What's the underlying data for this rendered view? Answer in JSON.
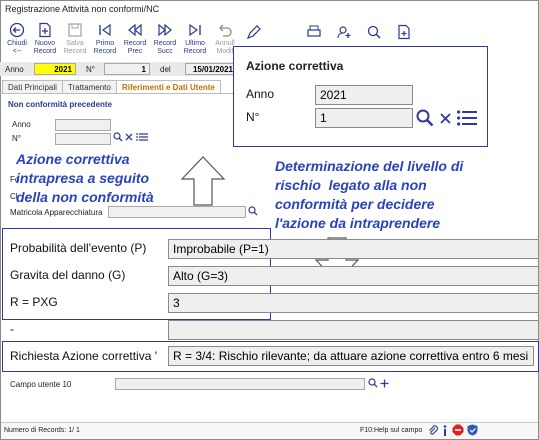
{
  "window": {
    "title": "Registrazione Attività non conformi/NC"
  },
  "toolbar": {
    "buttons": [
      {
        "label": "Chiudi\n<--"
      },
      {
        "label": "Nuovo\nRecord"
      },
      {
        "label": "Salva\nRecord"
      },
      {
        "label": "Primo\nRecord"
      },
      {
        "label": "Record\nPrec"
      },
      {
        "label": "Record\nSucc"
      },
      {
        "label": "Ultimo\nRecord"
      },
      {
        "label": "Annull\nModif"
      }
    ]
  },
  "header": {
    "anno_label": "Anno",
    "anno_value": "2021",
    "n_label": "N°",
    "n_value": "1",
    "del_label": "del",
    "date_value": "15/01/2021"
  },
  "tabs": [
    "Dati Principali",
    "Trattamento",
    "Riferimenti e Dati Utente"
  ],
  "nc_section": {
    "title": "Non conformità precedente",
    "anno_label": "Anno",
    "n_label": "N°",
    "fo_label": "Fo",
    "cl_label": "Cl",
    "matricola_label": "Matricola Apparecchiatura"
  },
  "azione_box": {
    "title": "Azione correttiva",
    "anno_label": "Anno",
    "anno_value": "2021",
    "n_label": "N°",
    "n_value": "1"
  },
  "annotations": {
    "left": "Azione correttiva\nintrapresa a seguito\ndella non conformità",
    "right": "Determinazione del livello di\nrischio  legato alla non\nconformità per decidere\nl'azione da intraprendere"
  },
  "risk_box": {
    "prob_label": "Probabilità dell'evento (P)",
    "prob_value": "Improbabile (P=1)",
    "gravita_label": "Gravita del danno (G)",
    "gravita_value": "Alto (G=3)",
    "r_label": "R = PXG",
    "r_value": "3"
  },
  "dash_label": "-",
  "richiesta": {
    "label": "Richiesta Azione correttiva '",
    "value": "R = 3/4: Rischio rilevante; da attuare azione correttiva entro 6 mesi"
  },
  "campo10": {
    "label": "Campo utente 10"
  },
  "statusbar": {
    "records": "Numero di Records: 1/ 1",
    "help": "F10:Help sul campo"
  },
  "colors": {
    "accent": "#2e3a9e",
    "annotation": "#2a43b8",
    "tab_active": "#c07000",
    "year_bg": "#ffff00"
  }
}
